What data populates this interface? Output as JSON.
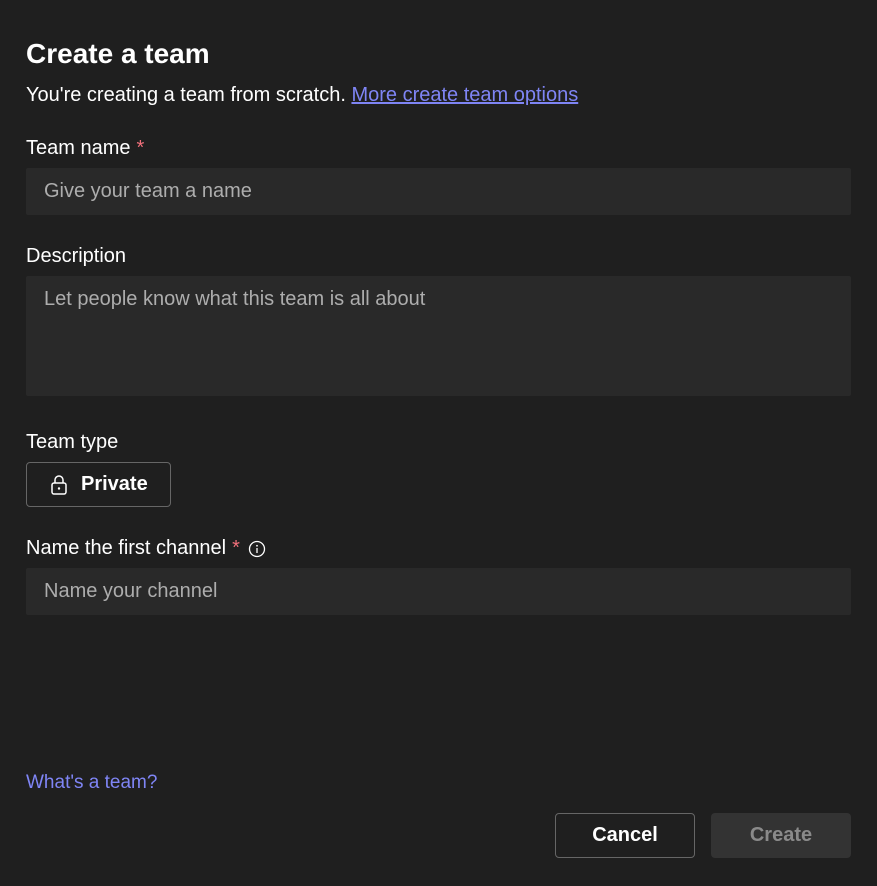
{
  "header": {
    "title": "Create a team",
    "subtitle_prefix": "You're creating a team from scratch. ",
    "more_options_link": "More create team options"
  },
  "fields": {
    "team_name": {
      "label": "Team name",
      "required_marker": "*",
      "placeholder": "Give your team a name",
      "value": ""
    },
    "description": {
      "label": "Description",
      "placeholder": "Let people know what this team is all about",
      "value": ""
    },
    "team_type": {
      "label": "Team type",
      "selected": "Private"
    },
    "first_channel": {
      "label": "Name the first channel",
      "required_marker": "*",
      "placeholder": "Name your channel",
      "value": ""
    }
  },
  "footer": {
    "help_link": "What's a team?",
    "cancel_button": "Cancel",
    "create_button": "Create"
  }
}
